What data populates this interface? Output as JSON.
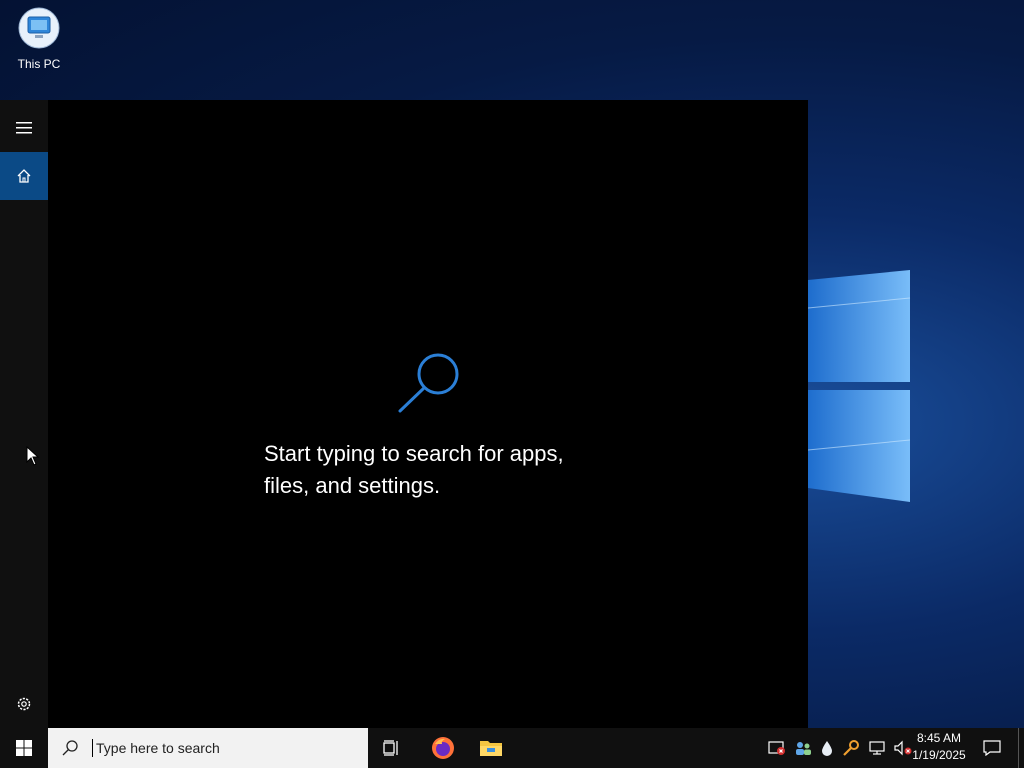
{
  "desktop": {
    "icons": [
      {
        "label": "This PC",
        "icon": "this-pc-icon"
      }
    ]
  },
  "start_panel": {
    "rail": {
      "menu_icon": "hamburger-icon",
      "home_icon": "home-icon",
      "settings_icon": "gear-icon"
    },
    "hint_line1": "Start typing to search for apps,",
    "hint_line2": "files, and settings."
  },
  "taskbar": {
    "start_icon": "windows-start-icon",
    "search": {
      "placeholder": "Type here to search",
      "value": ""
    },
    "pinned": [
      {
        "name": "Task View",
        "icon": "task-view-icon"
      },
      {
        "name": "Firefox",
        "icon": "firefox-icon"
      },
      {
        "name": "File Explorer",
        "icon": "folder-icon"
      }
    ],
    "tray_icons": [
      "security-alert-icon",
      "people-icon",
      "droplet-icon",
      "key-icon",
      "network-icon",
      "volume-muted-icon"
    ],
    "clock": {
      "time": "8:45 AM",
      "date": "1/19/2025"
    },
    "notification_icon": "action-center-icon"
  },
  "colors": {
    "accent": "#0b4a86",
    "panel_bg": "#000000",
    "taskbar_bg": "#101010",
    "search_box_bg": "#f2f2f2"
  }
}
